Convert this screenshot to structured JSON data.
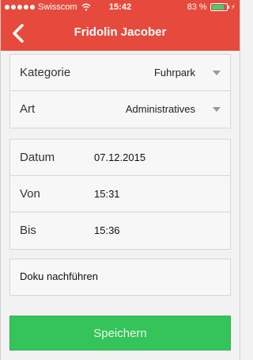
{
  "status_bar": {
    "carrier": "Swisscom",
    "time": "15:42",
    "battery": "83 %",
    "battery_level": 0.83,
    "icons": [
      "signal-dots-icon",
      "wifi-icon",
      "battery-icon",
      "charging-bolt-icon"
    ]
  },
  "navbar": {
    "title": "Fridolin Jacober",
    "back_icon": "chevron-left-icon"
  },
  "classification": {
    "kategorie_label": "Kategorie",
    "kategorie_value": "Fuhrpark",
    "art_label": "Art",
    "art_value": "Administratives"
  },
  "time_entry": {
    "datum_label": "Datum",
    "datum_value": "07.12.2015",
    "von_label": "Von",
    "von_value": "15:31",
    "bis_label": "Bis",
    "bis_value": "15:36"
  },
  "doku": {
    "label": "Doku nachführen"
  },
  "actions": {
    "save_label": "Speichern"
  },
  "colors": {
    "accent": "#e64a3c",
    "save_button": "#35c45a"
  }
}
